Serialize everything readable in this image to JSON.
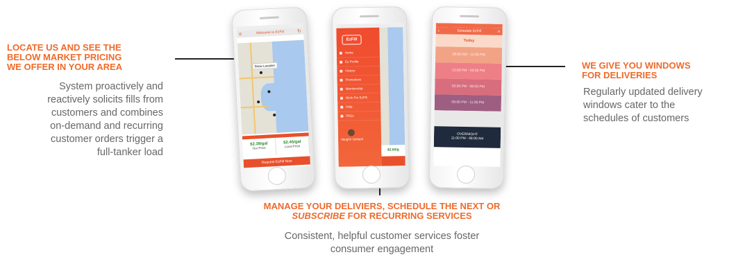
{
  "callouts": {
    "left": {
      "heading_lines": [
        "LOCATE US AND SEE THE",
        "BELOW MARKET PRICING",
        "WE OFFER IN YOUR AREA"
      ],
      "body_lines": [
        "System proactively and",
        "reactively solicits fills from",
        "customers and combines",
        "on-demand and recurring",
        "customer orders trigger a",
        "full-tanker load"
      ]
    },
    "right": {
      "heading_lines": [
        "WE GIVE YOU WINDOWS",
        "FOR DELIVERIES"
      ],
      "body_lines": [
        "Regularly updated delivery",
        "windows cater to the",
        "schedules of customers"
      ]
    },
    "bottom": {
      "heading_line1": "MANAGE YOUR DELIVIERS, SCHEDULE THE NEXT OR",
      "heading_line2_em": "SUBSCRIBE",
      "heading_line2_rest": " FOR RECURRING SERVICES",
      "body_lines": [
        "Consistent, helpful customer services foster",
        "consumer engagement"
      ]
    }
  },
  "phone1": {
    "title": "Welcome to EzFill",
    "search": "",
    "location_label": "Show Location",
    "price_left": "$2.39/gal",
    "price_left_caption": "Our Price",
    "price_right": "$2.45/gal",
    "price_right_caption": "Local Price",
    "cta": "Request EzFill Now"
  },
  "phone2": {
    "logo": "EzFill",
    "menu_items": [
      "Home",
      "Ez Profile",
      "History",
      "Promotions",
      "Membership",
      "Work For EzFill",
      "Help",
      "FAQs"
    ],
    "user": "Vaughn Gerlach",
    "price": "$2.66/g"
  },
  "phone3": {
    "title": "Schedule EzFill",
    "day": "Today",
    "windows": [
      "09:00 AM - 12:00 PM",
      "12:00 PM - 03:00 PM",
      "03:00 PM - 06:00 PM",
      "06:00 PM - 11:00 PM",
      ""
    ],
    "overnight_label": "OVERNIGHT",
    "overnight_time": "11:00 PM - 06:00 AM",
    "colors": [
      "#f2a386",
      "#ef7f86",
      "#d86d7e",
      "#9e5e82",
      "#e8e8e8",
      "#1f2a3c"
    ]
  }
}
